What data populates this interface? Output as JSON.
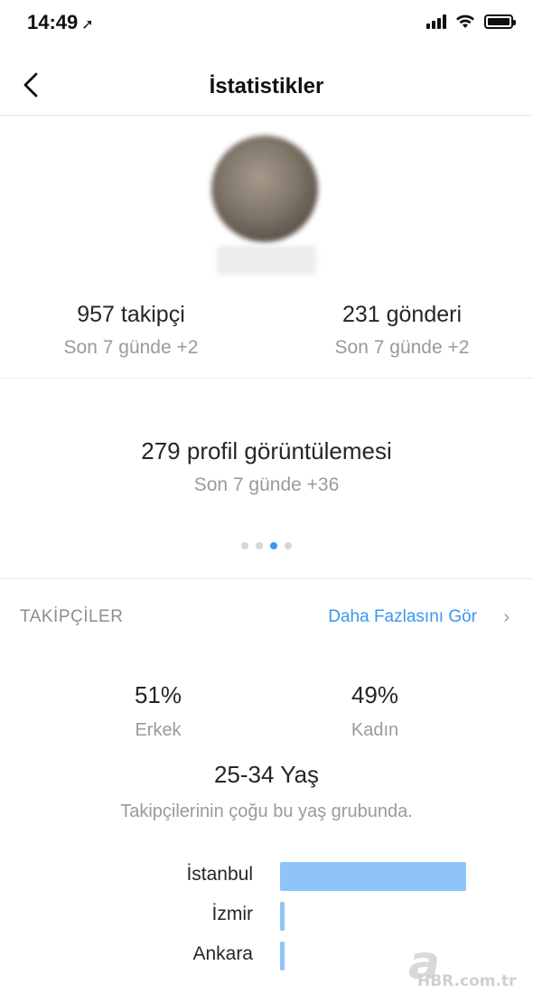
{
  "status_bar": {
    "time": "14:49",
    "location_icon": "location-arrow-icon"
  },
  "nav": {
    "title": "İstatistikler",
    "back_icon": "chevron-left-icon"
  },
  "stats": {
    "followers": {
      "value": "957 takipçi",
      "change": "Son 7 günde +2"
    },
    "posts": {
      "value": "231 gönderi",
      "change": "Son 7 günde +2"
    },
    "profile_views": {
      "value": "279 profil görüntülemesi",
      "change": "Son 7 günde +36"
    }
  },
  "pager": {
    "count": 4,
    "active_index": 2
  },
  "followers_section": {
    "title": "TAKİPÇİLER",
    "see_more": "Daha Fazlasını Gör",
    "gender": {
      "male": {
        "percent": "51%",
        "label": "Erkek"
      },
      "female": {
        "percent": "49%",
        "label": "Kadın"
      }
    },
    "age": {
      "range": "25-34 Yaş",
      "caption": "Takipçilerinin çoğu bu yaş grubunda."
    },
    "cities": [
      {
        "name": "İstanbul",
        "share": 1.0
      },
      {
        "name": "İzmir",
        "share": 0.02
      },
      {
        "name": "Ankara",
        "share": 0.02
      }
    ]
  },
  "watermark": {
    "letter": "a",
    "text": "HBR.com.tr"
  },
  "colors": {
    "accent": "#3897f0",
    "bar": "#8ec4f7",
    "muted": "#9a9a9a"
  }
}
